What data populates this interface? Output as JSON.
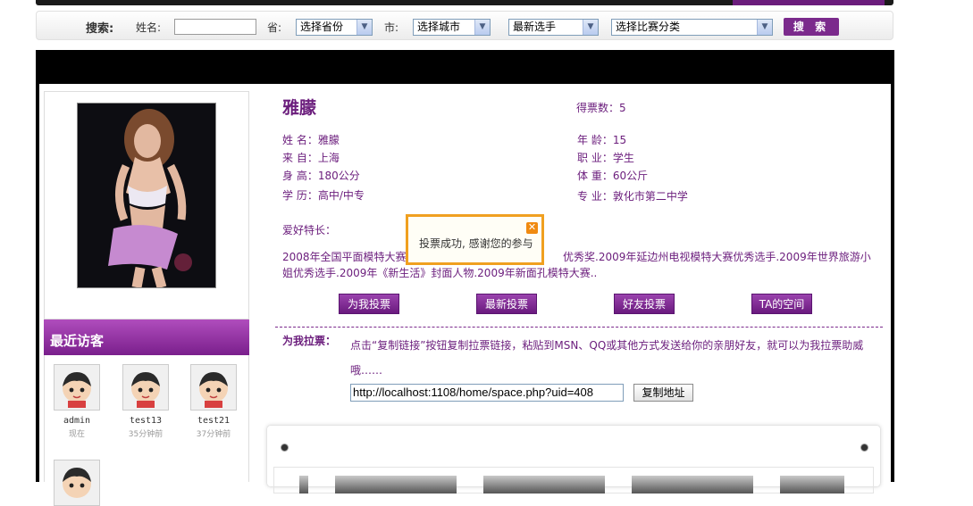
{
  "search": {
    "title": "搜索:",
    "name_label": "姓名:",
    "name_value": "",
    "province_label": "省:",
    "province_select": "选择省份",
    "city_label": "市:",
    "city_select": "选择城市",
    "sort_select": "最新选手",
    "category_select": "选择比赛分类",
    "search_button": "搜 索"
  },
  "profile": {
    "display_name": "雅朦",
    "votes": "得票数：5",
    "fields": {
      "name": "姓  名：雅朦",
      "from": "来  自：上海",
      "height": "身  高：180公分",
      "education": "学  历：高中/中专",
      "age": "年  龄：15",
      "job": "职  业：学生",
      "weight": "体  重：60公斤",
      "major": "专  业：敦化市第二中学"
    },
    "hobby_label": "爱好特长：",
    "hobby_text": "2008年全国平面模特大赛                                              优秀奖.2009年延边州电视模特大赛优秀选手.2009年世界旅游小姐优秀选手.2009年《新生活》封面人物.2009年新面孔模特大赛.."
  },
  "actions": {
    "vote_me": "为我投票",
    "latest_votes": "最新投票",
    "friend_votes": "好友投票",
    "space": "TA的空间"
  },
  "invite": {
    "label": "为我拉票：",
    "text": "点击“复制链接”按钮复制拉票链接，粘贴到MSN、QQ或其他方式发送给你的亲朋好友，就可以为我拉票助威哦……",
    "url": "http://localhost:1108/home/space.php?uid=408",
    "copy_button": "复制地址"
  },
  "popup": {
    "message": "投票成功, 感谢您的参与"
  },
  "visitors": {
    "title": "最近访客",
    "items": [
      {
        "name": "admin",
        "time": "现在"
      },
      {
        "name": "test13",
        "time": "35分钟前"
      },
      {
        "name": "test21",
        "time": "37分钟前"
      }
    ]
  },
  "colors": {
    "brand_purple": "#6b1d7c",
    "popup_border": "#f0a020"
  }
}
